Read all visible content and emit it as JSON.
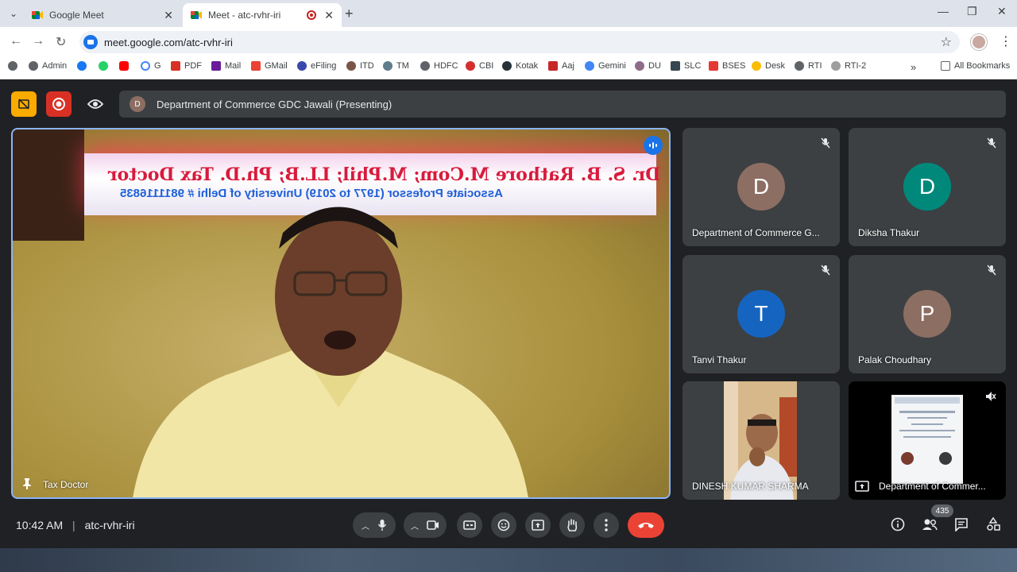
{
  "browser": {
    "tabs": [
      {
        "title": "Google Meet",
        "active": false
      },
      {
        "title": "Meet - atc-rvhr-iri",
        "active": true
      }
    ],
    "url": "meet.google.com/atc-rvhr-iri",
    "bookmarks": [
      "Admin",
      "G",
      "PDF",
      "Mail",
      "GMail",
      "eFiling",
      "ITD",
      "TM",
      "HDFC",
      "CBI",
      "Kotak",
      "Aaj",
      "Gemini",
      "DU",
      "SLC",
      "BSES",
      "Desk",
      "RTI",
      "RTI-2"
    ],
    "all_bookmarks": "All Bookmarks"
  },
  "meet": {
    "presenting_avatar": "D",
    "presenting_text": "Department of Commerce GDC Jawali (Presenting)",
    "main_video": {
      "label": "Tax Doctor",
      "sign_line1": "Dr. S. B. Rathore M.Com; M.Phil; LL.B; Ph.D. Tax Doctor",
      "sign_line2": "Associate Professor (1977 to 2019) University of Delhi # 9811116835"
    },
    "tiles": [
      {
        "initial": "D",
        "name": "Department of Commerce G...",
        "color": "#8d6e63"
      },
      {
        "initial": "D",
        "name": "Diksha Thakur",
        "color": "#00897b"
      },
      {
        "initial": "T",
        "name": "Tanvi Thakur",
        "color": "#1565c0"
      },
      {
        "initial": "P",
        "name": "Palak Choudhary",
        "color": "#8d6e63"
      },
      {
        "name": "DINESH KUMAR SHARMA"
      },
      {
        "name": "Department of Commer..."
      }
    ],
    "time": "10:42 AM",
    "separator": "|",
    "meeting_code": "atc-rvhr-iri",
    "participant_count": "435"
  }
}
